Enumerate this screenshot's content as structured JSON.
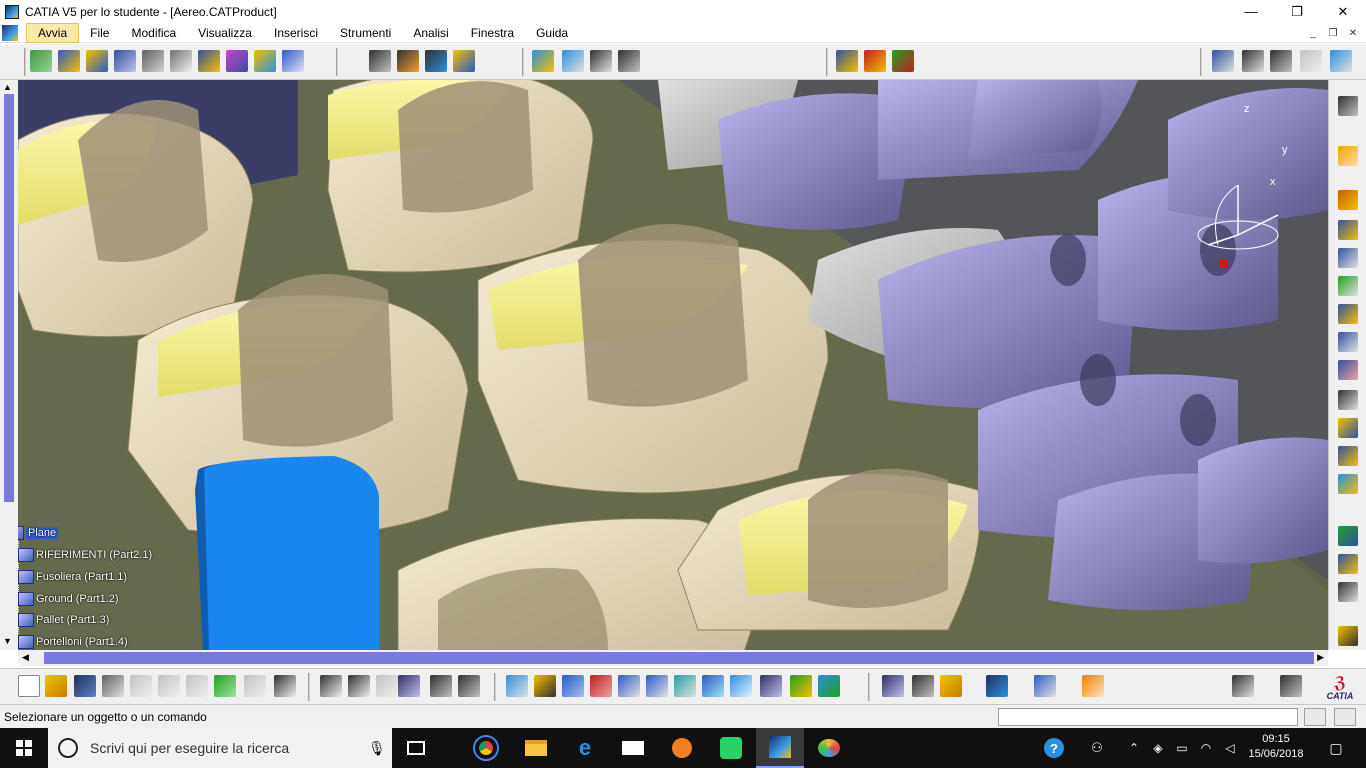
{
  "window": {
    "title": "CATIA V5 per lo studente - [Aereo.CATProduct]",
    "controls": {
      "minimize": "—",
      "maximize": "❐",
      "close": "✕"
    }
  },
  "menu": {
    "items": [
      "Avvia",
      "File",
      "Modifica",
      "Visualizza",
      "Inserisci",
      "Strumenti",
      "Analisi",
      "Finestra",
      "Guida"
    ],
    "mdi": {
      "minimize": "_",
      "restore": "❐",
      "close": "✕"
    }
  },
  "tree": {
    "root": "Plane",
    "children": [
      "RIFERIMENTI (Part2.1)",
      "Fusoliera (Part1.1)",
      "Ground (Part1.2)",
      "Pallet (Part1.3)",
      "Portelloni (Part1.4)"
    ]
  },
  "compass": {
    "x": "x",
    "y": "y",
    "z": "z"
  },
  "status": {
    "message": "Selezionare un oggetto o un comando"
  },
  "taskbar": {
    "search_placeholder": "Scrivi qui per eseguire la ricerca",
    "time": "09:15",
    "date": "15/06/2018"
  },
  "brand": {
    "logo_text": "CATIA"
  },
  "colors": {
    "accent": "#7a7adc",
    "menu_active": "#fbe9a8",
    "viewport_bg": "#5f6249",
    "seat_light": "#e8dcc0",
    "seat_yellow": "#f3f08a",
    "seat_purple": "#9c98d6",
    "door_blue": "#1a86ef"
  }
}
